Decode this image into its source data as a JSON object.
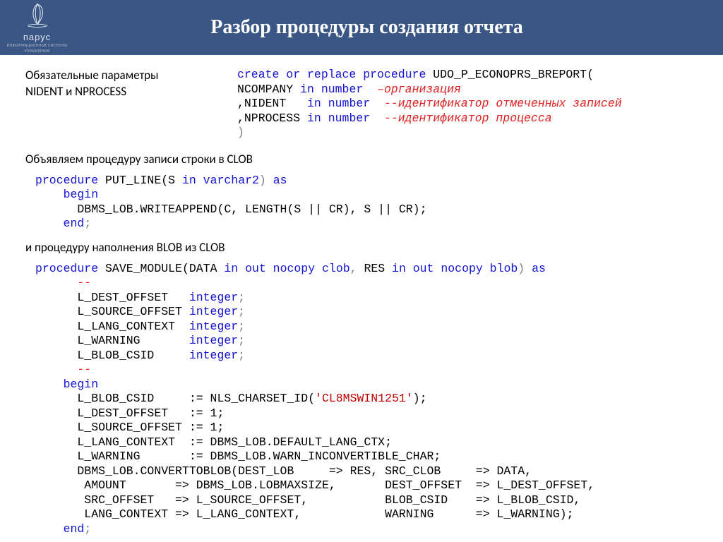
{
  "logo": {
    "brand": "парус",
    "tagline": "ИНФОРМАЦИОННЫЕ СИСТЕМЫ УПРАВЛЕНИЯ"
  },
  "title": "Разбор процедуры создания отчета",
  "left_note": {
    "l1": "Обязательные параметры",
    "l2": "NIDENT и NPROCESS"
  },
  "code1": {
    "k_create": "create or replace procedure",
    "name": " UDO_P_ECONOPRS_BREPORT(",
    "l2a": "NCOMPANY ",
    "k_in1": "in",
    "k_num1": " number  ",
    "c1": "–организация",
    "l3a": ",NIDENT   ",
    "k_in2": "in",
    "k_num2": " number  ",
    "c2": "--идентификатор отмеченных записей",
    "l4a": ",NPROCESS ",
    "k_in3": "in",
    "k_num3": " number  ",
    "c3": "--идентификатор процесса",
    "close": ")"
  },
  "sec2": "Объявляем процедуру записи строки в CLOB",
  "code2": {
    "k_proc": "procedure",
    "name": " PUT_LINE(",
    "arg_s": "S ",
    "k_in": "in",
    "k_type": " varchar2",
    "close_p": ")",
    "k_as": " as",
    "k_begin": "    begin",
    "body": "      DBMS_LOB.WRITEAPPEND(C, LENGTH(S || CR), S || CR);",
    "k_end": "    end",
    "semi": ";"
  },
  "sec3": "и процедуру наполнения BLOB из CLOB",
  "code3": {
    "k_proc": "procedure",
    "name": " SAVE_MODULE(",
    "arg1": "DATA ",
    "k_ino1": "in out nocopy",
    "t1": " clob",
    "comma": ", ",
    "arg2": "RES ",
    "k_ino2": "in out nocopy",
    "t2": " blob",
    "close_p": ")",
    "k_as": " as",
    "dash1": "      --",
    "d1a": "      L_DEST_OFFSET   ",
    "k_int": "integer",
    "semi": ";",
    "d2a": "      L_SOURCE_OFFSET ",
    "d3a": "      L_LANG_CONTEXT  ",
    "d4a": "      L_WARNING       ",
    "d5a": "      L_BLOB_CSID     ",
    "dash2": "      --",
    "k_begin": "    begin",
    "b1a": "      L_BLOB_CSID     := NLS_CHARSET_ID(",
    "str": "'CL8MSWIN1251'",
    "b1b": ");",
    "b2": "      L_DEST_OFFSET   := 1;",
    "b3": "      L_SOURCE_OFFSET := 1;",
    "b4": "      L_LANG_CONTEXT  := DBMS_LOB.DEFAULT_LANG_CTX;",
    "b5": "      L_WARNING       := DBMS_LOB.WARN_INCONVERTIBLE_CHAR;",
    "b6": "      DBMS_LOB.CONVERTTOBLOB(DEST_LOB     => RES, SRC_CLOB     => DATA,",
    "b7": "       AMOUNT       => DBMS_LOB.LOBMAXSIZE,       DEST_OFFSET  => L_DEST_OFFSET,",
    "b8": "       SRC_OFFSET   => L_SOURCE_OFFSET,           BLOB_CSID    => L_BLOB_CSID,",
    "b9": "       LANG_CONTEXT => L_LANG_CONTEXT,            WARNING      => L_WARNING);",
    "k_end": "    end",
    "esemi": ";"
  }
}
